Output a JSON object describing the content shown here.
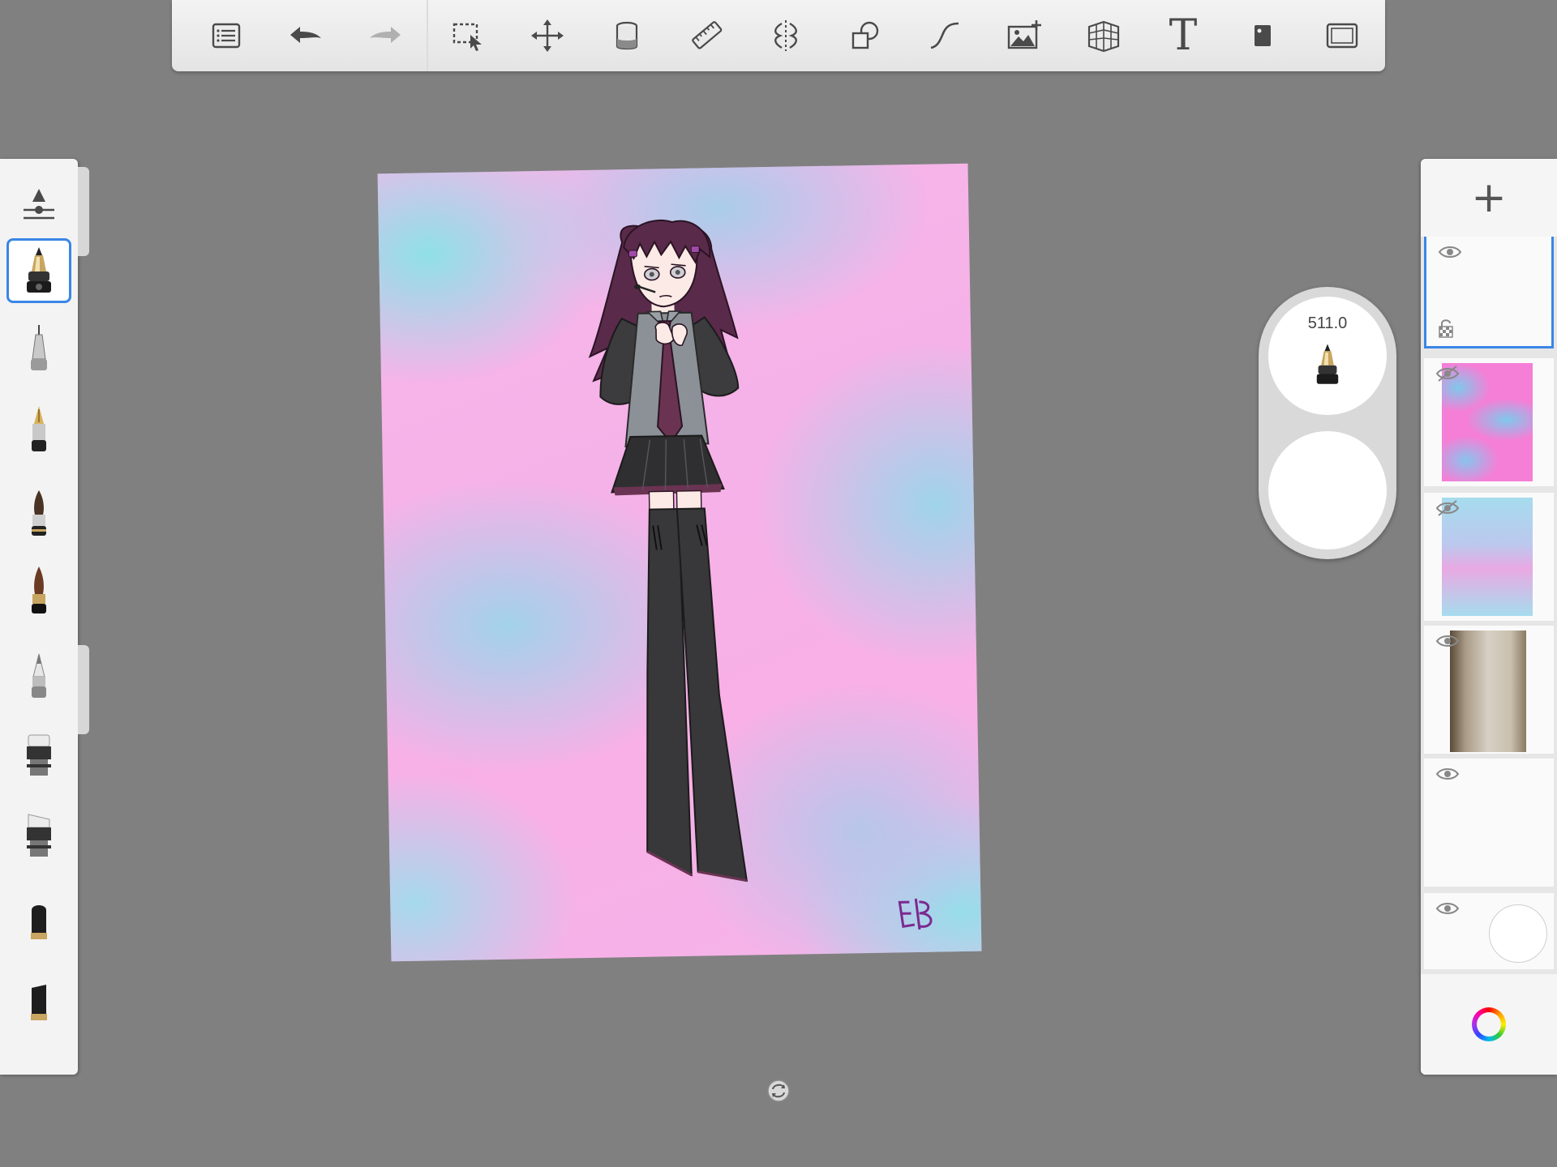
{
  "toolbar": {
    "tools": [
      {
        "name": "gallery-list",
        "icon": "list-icon"
      },
      {
        "name": "undo",
        "icon": "undo-arrow-icon"
      },
      {
        "name": "redo",
        "icon": "redo-arrow-icon"
      },
      {
        "name": "selection",
        "icon": "selection-icon"
      },
      {
        "name": "transform",
        "icon": "move-arrows-icon"
      },
      {
        "name": "fill",
        "icon": "paint-bucket-icon"
      },
      {
        "name": "ruler",
        "icon": "ruler-icon"
      },
      {
        "name": "symmetry",
        "icon": "symmetry-icon"
      },
      {
        "name": "shapes",
        "icon": "shapes-icon"
      },
      {
        "name": "stroke",
        "icon": "curve-icon"
      },
      {
        "name": "import-image",
        "icon": "image-add-icon"
      },
      {
        "name": "perspective",
        "icon": "perspective-grid-icon"
      },
      {
        "name": "text",
        "icon": "text-icon",
        "label": "T"
      },
      {
        "name": "stencil",
        "icon": "stencil-icon"
      },
      {
        "name": "fullscreen",
        "icon": "fullscreen-icon"
      }
    ]
  },
  "brushes": {
    "items": [
      "brush-settings",
      "ink-pen",
      "technical-pen",
      "fountain-pen",
      "paint-brush",
      "airbrush",
      "pencil",
      "eraser",
      "eraser-hard",
      "marker",
      "chisel-marker"
    ],
    "selected": "ink-pen"
  },
  "brush_puck": {
    "size_value": "511.0",
    "opacity_color": "#ffffff"
  },
  "layers": {
    "add_label": "+",
    "items": [
      {
        "name": "layer-1",
        "visible": true,
        "active": true,
        "locked_icon": "transparency-lock-icon"
      },
      {
        "name": "layer-2",
        "visible": false,
        "thumb": "pink-blue-blob"
      },
      {
        "name": "layer-3",
        "visible": false,
        "thumb": "pink-blue-wash"
      },
      {
        "name": "layer-4",
        "visible": true,
        "thumb": "sketch-photo"
      },
      {
        "name": "layer-5",
        "visible": true,
        "thumb": "blank"
      },
      {
        "name": "background-layer",
        "visible": true,
        "thumb": "white-circle"
      }
    ]
  },
  "colors": {
    "accent": "#3a86e6",
    "hair": "#5a2a4a",
    "outfit_grey": "#8a9096",
    "dark_cloth": "#38383a",
    "tie": "#6b3352",
    "signature": "#7b2a90"
  },
  "signature": "EB"
}
